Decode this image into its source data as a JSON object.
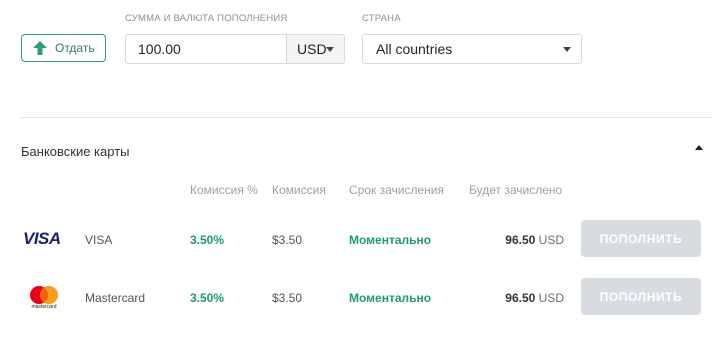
{
  "controls": {
    "give_label": "Отдать",
    "amount_label": "СУММА И ВАЛЮТА ПОПОЛНЕНИЯ",
    "amount_value": "100.00",
    "currency_value": "USD",
    "country_label": "СТРАНА",
    "country_value": "All countries"
  },
  "section": {
    "title": "Банковские карты"
  },
  "columns": {
    "commission_pct": "Комиссия %",
    "commission": "Комиссия",
    "term": "Срок зачисления",
    "credited": "Будет зачислено"
  },
  "rows": [
    {
      "logo_text": "VISA",
      "logo_icon": "visa-logo",
      "name": "VISA",
      "commission_pct": "3.50%",
      "commission": "$3.50",
      "term": "Моментально",
      "credited_amount": "96.50",
      "credited_currency": "USD",
      "button": "ПОПОЛНИТЬ"
    },
    {
      "logo_text": "mastercard",
      "logo_icon": "mastercard-logo",
      "name": "Mastercard",
      "commission_pct": "3.50%",
      "commission": "$3.50",
      "term": "Моментально",
      "credited_amount": "96.50",
      "credited_currency": "USD",
      "button": "ПОПОЛНИТЬ"
    }
  ],
  "colors": {
    "accent_green": "#1e9b72",
    "disabled_button": "#d8dce0",
    "visa_blue": "#1a1f71",
    "mc_red": "#eb001b",
    "mc_orange": "#f79e1b"
  }
}
